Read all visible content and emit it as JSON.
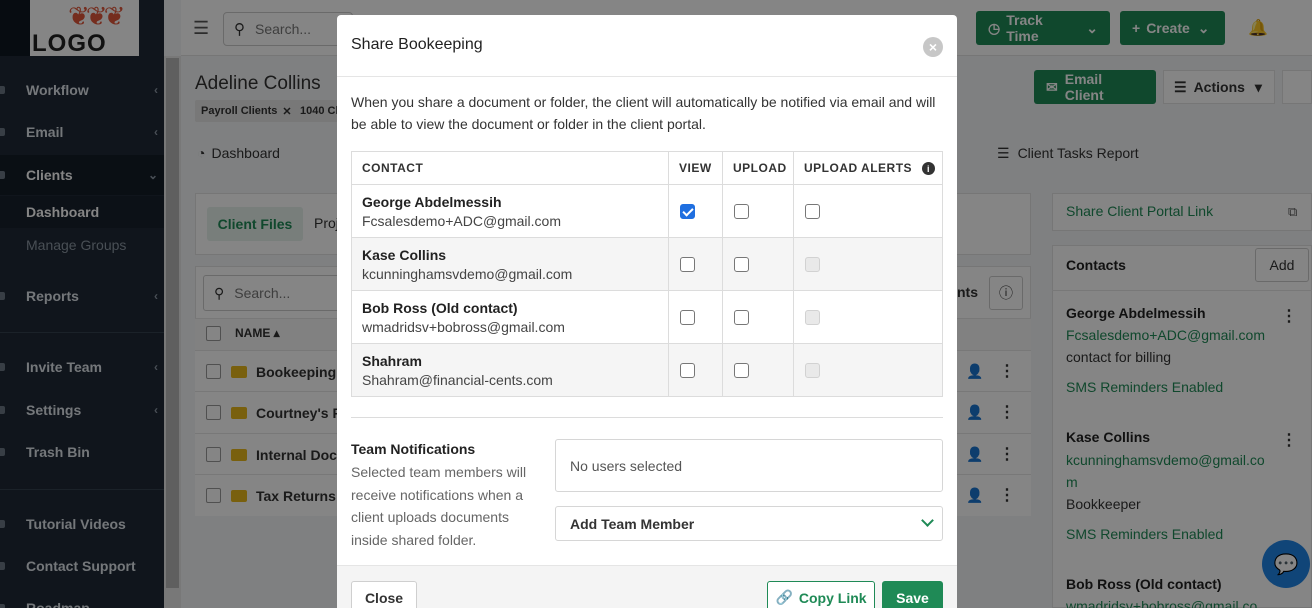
{
  "app": {
    "logo_text": "LOGO",
    "search_placeholder": "Search...",
    "track_time_label": "Track Time",
    "create_label": "Create"
  },
  "sidebar": {
    "items": [
      {
        "label": "Workflow"
      },
      {
        "label": "Email"
      },
      {
        "label": "Clients"
      },
      {
        "label": "Reports"
      },
      {
        "label": "Invite Team"
      },
      {
        "label": "Settings"
      },
      {
        "label": "Trash Bin"
      },
      {
        "label": "Tutorial Videos"
      },
      {
        "label": "Contact Support"
      },
      {
        "label": "Roadmap"
      }
    ],
    "sub_items": [
      {
        "label": "Dashboard"
      },
      {
        "label": "Manage Groups"
      }
    ]
  },
  "client": {
    "name": "Adeline Collins",
    "tags": [
      "Payroll Clients",
      "1040 Cl"
    ],
    "subnav": [
      "Dashboard",
      "Client Tasks Report"
    ],
    "email_client_label": "Email Client",
    "actions_label": "Actions",
    "files_tab": "Client Files",
    "files_tab_2": "Proj",
    "files_search_placeholder": "Search...",
    "files_col_name": "NAME",
    "files_col_right": "nts",
    "folders": [
      "Bookeeping",
      "Courtney's F",
      "Internal Doc",
      "Tax Returns"
    ]
  },
  "right_panel": {
    "share_portal_label": "Share Client Portal Link",
    "contacts_title": "Contacts",
    "add_label": "Add",
    "contacts": [
      {
        "name": "George Abdelmessih",
        "email": "Fcsalesdemo+ADC@gmail.com",
        "note": "contact for billing",
        "sms": "SMS Reminders Enabled"
      },
      {
        "name": "Kase Collins",
        "email_line1": "kcunninghamsvdemo@gmail.co",
        "email_line2": "m",
        "note": "Bookkeeper",
        "sms": "SMS Reminders Enabled"
      },
      {
        "name": "Bob Ross (Old contact)",
        "email": "wmadridsv+bobross@gmail.co"
      }
    ]
  },
  "modal": {
    "title": "Share Bookeeping",
    "intro": "When you share a document or folder, the client will automatically be notified via email and will be able to view the document or folder in the client portal.",
    "columns": {
      "contact": "CONTACT",
      "view": "VIEW",
      "upload": "UPLOAD",
      "alerts": "UPLOAD ALERTS"
    },
    "rows": [
      {
        "name": "George Abdelmessih",
        "email": "Fcsalesdemo+ADC@gmail.com",
        "view": true,
        "upload": false,
        "alerts": false,
        "alerts_enabled": true
      },
      {
        "name": "Kase Collins",
        "email": "kcunninghamsvdemo@gmail.com",
        "view": false,
        "upload": false,
        "alerts": false,
        "alerts_enabled": false
      },
      {
        "name": "Bob Ross (Old contact)",
        "email": "wmadridsv+bobross@gmail.com",
        "view": false,
        "upload": false,
        "alerts": false,
        "alerts_enabled": false
      },
      {
        "name": "Shahram",
        "email": "Shahram@financial-cents.com",
        "view": false,
        "upload": false,
        "alerts": false,
        "alerts_enabled": false
      }
    ],
    "team": {
      "title": "Team Notifications",
      "description": "Selected team members will receive notifications when a client uploads documents inside shared folder.",
      "selected_text": "No users selected",
      "add_label": "Add Team Member"
    },
    "footer": {
      "close_label": "Close",
      "copy_link_label": "Copy Link",
      "save_label": "Save"
    }
  },
  "colors": {
    "accent_green": "#1f8a56",
    "sidebar_bg": "#1f2a37",
    "checkbox_blue": "#1f6fe0"
  }
}
